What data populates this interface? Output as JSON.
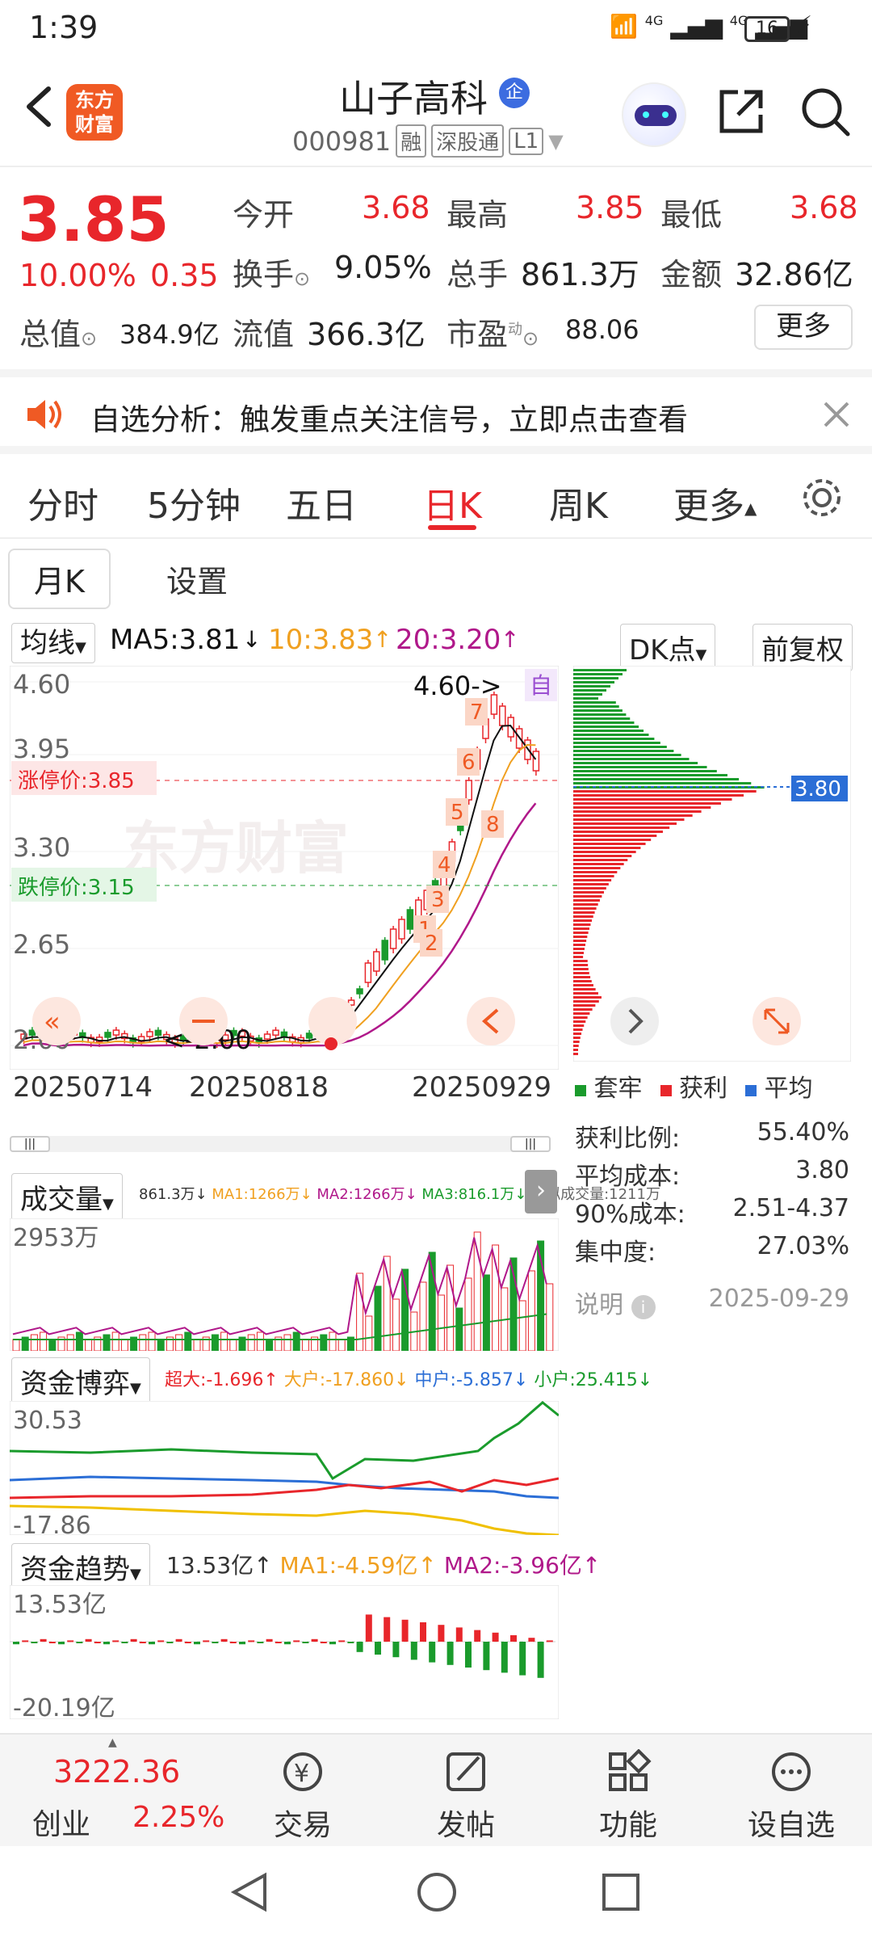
{
  "status": {
    "time": "1:39",
    "network": "4G",
    "battery": "16"
  },
  "header": {
    "brand_logo_line1": "东方",
    "brand_logo_line2": "财富",
    "stock_name": "山子高科",
    "badge": "企",
    "code": "000981",
    "tags": [
      "融",
      "深股通",
      "L1"
    ]
  },
  "quote": {
    "price": "3.85",
    "change_pct": "10.00%",
    "change": "0.35",
    "items": [
      {
        "label": "今开",
        "value": "3.68"
      },
      {
        "label": "最高",
        "value": "3.85"
      },
      {
        "label": "最低",
        "value": "3.68"
      },
      {
        "label": "换手",
        "value": "9.05%"
      },
      {
        "label": "总手",
        "value": "861.3万"
      },
      {
        "label": "金额",
        "value": "32.86亿"
      },
      {
        "label": "总值",
        "value": "384.9亿"
      },
      {
        "label": "流值",
        "value": "366.3亿"
      },
      {
        "label": "市盈",
        "value": "88.06",
        "sup": "动"
      }
    ],
    "more_button": "更多"
  },
  "banner": {
    "text": "自选分析：触发重点关注信号，立即点击查看"
  },
  "tabs": [
    "分时",
    "5分钟",
    "五日",
    "日K",
    "周K",
    "更多"
  ],
  "active_tab": "日K",
  "sub_tabs": {
    "monthly": "月K",
    "settings": "设置"
  },
  "kchart": {
    "ma_selector": "均线",
    "ma5": "MA5:3.81",
    "ma10": "10:3.83",
    "ma20": "20:3.20",
    "dk_button": "DK点",
    "fq_button": "前复权",
    "y_labels": [
      "4.60",
      "3.95",
      "3.30",
      "2.65",
      "2.00"
    ],
    "limit_up": "涨停价:3.85",
    "limit_down": "跌停价:3.15",
    "max_label": "4.60->",
    "min_label": "<-2.00",
    "auto_label": "自",
    "markers": [
      "1",
      "2",
      "3",
      "4",
      "5",
      "6",
      "7",
      "8"
    ],
    "dates": [
      "20250714",
      "20250818",
      "20250929"
    ],
    "watermark": "东方财富",
    "colors": {
      "up": "#e8262b",
      "down": "#1a9b2c",
      "ma5": "#111111",
      "ma10": "#f0a020",
      "ma20": "#b0188a"
    }
  },
  "chip_dist": {
    "price_tag": "3.80",
    "legend": [
      "套牢",
      "获利",
      "平均"
    ],
    "stats": [
      {
        "label": "获利比例:",
        "value": "55.40%"
      },
      {
        "label": "平均成本:",
        "value": "3.80"
      },
      {
        "label": "90%成本:",
        "value": "2.51-4.37"
      },
      {
        "label": "集中度:",
        "value": "27.03%"
      }
    ],
    "note_label": "说明",
    "date": "2025-09-29"
  },
  "volume": {
    "selector": "成交量",
    "values": {
      "v": "861.3万↓",
      "ma1": "MA1:1266万↓",
      "ma2": "MA2:1266万↓",
      "ma3": "MA3:816.1万↓",
      "virtual": "虚拟成交量:1211万"
    },
    "y_label": "2953万"
  },
  "fund_game": {
    "selector": "资金博弈",
    "values": {
      "chao": "超大:-1.696↑",
      "da": "大户:-17.860↓",
      "zhong": "中户:-5.857↓",
      "xiao": "小户:25.415↓"
    },
    "y_top": "30.53",
    "y_bottom": "-17.86"
  },
  "fund_trend": {
    "selector": "资金趋势",
    "values": {
      "v": "13.53亿↑",
      "ma1": "MA1:-4.59亿↑",
      "ma2": "MA2:-3.96亿↑"
    },
    "y_top": "13.53亿",
    "y_bottom": "-20.19亿"
  },
  "bottom_nav": {
    "index_value": "3222.36",
    "index_name": "创业",
    "index_pct": "2.25%",
    "items": [
      "交易",
      "发帖",
      "功能",
      "设自选"
    ]
  }
}
